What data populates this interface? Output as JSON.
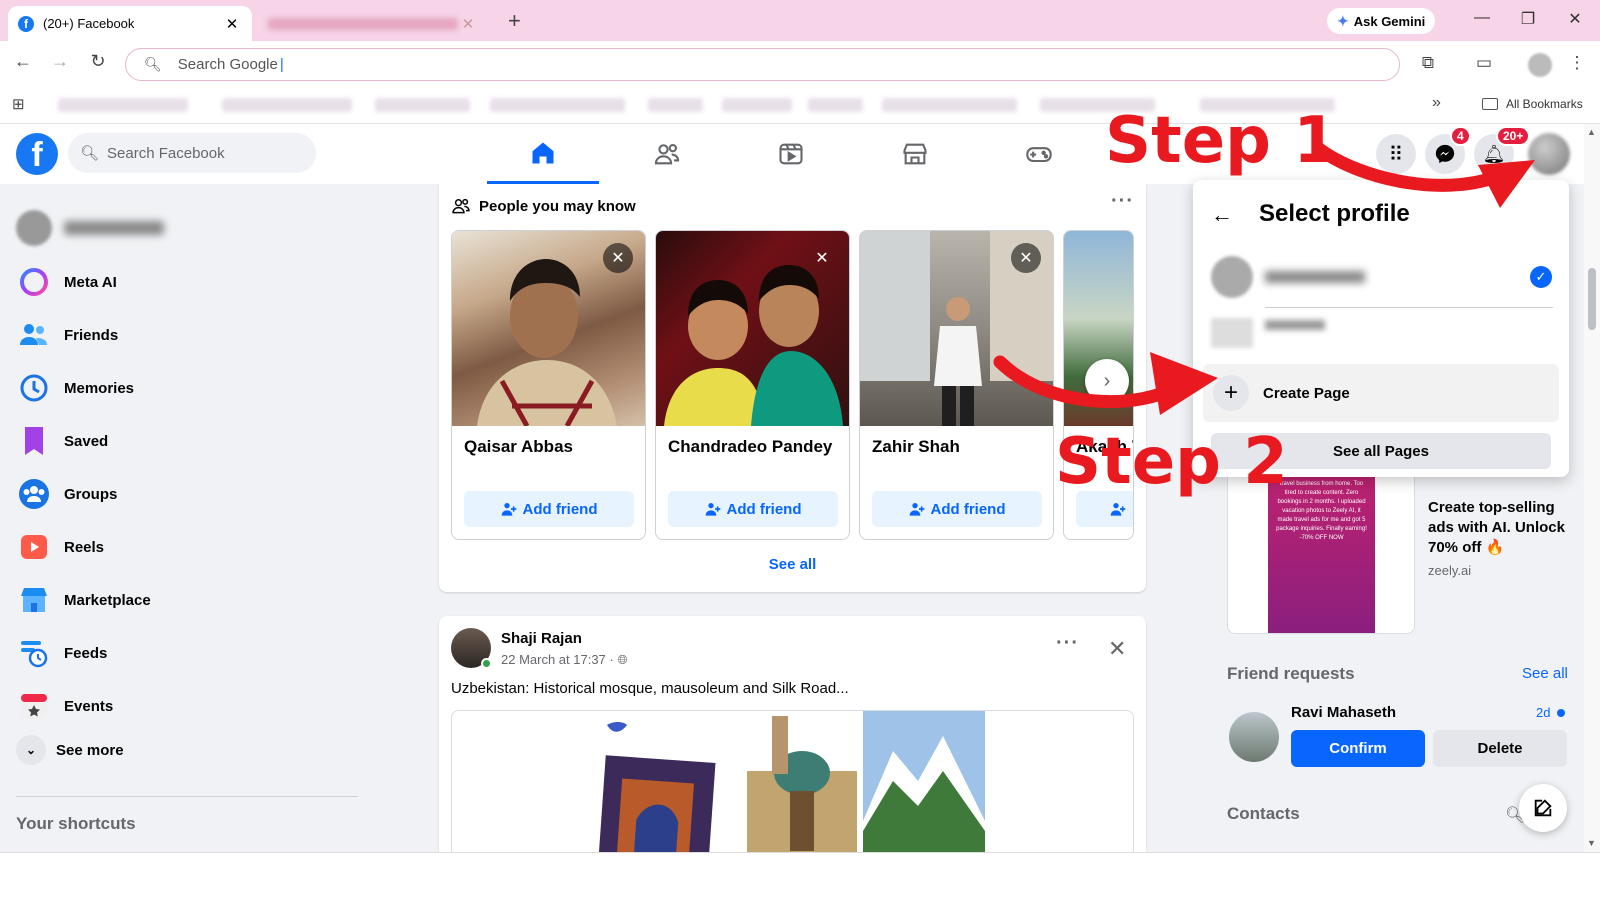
{
  "browser": {
    "active_tab_title": "(20+) Facebook",
    "new_tab_icon": "plus-icon",
    "ask_gemini_label": "Ask Gemini",
    "address_placeholder": "Search Google",
    "all_bookmarks_label": "All Bookmarks"
  },
  "fb_header": {
    "logo_letter": "f",
    "search_placeholder": "Search Facebook",
    "nav_tabs": [
      "home",
      "friends",
      "video",
      "marketplace",
      "gaming"
    ],
    "messenger_badge": "4",
    "notifications_badge": "20+"
  },
  "sidebar": {
    "items": [
      {
        "label": "Meta AI",
        "icon": "meta-ai-icon"
      },
      {
        "label": "Friends",
        "icon": "friends-icon"
      },
      {
        "label": "Memories",
        "icon": "memories-icon"
      },
      {
        "label": "Saved",
        "icon": "saved-icon"
      },
      {
        "label": "Groups",
        "icon": "groups-icon"
      },
      {
        "label": "Reels",
        "icon": "reels-icon"
      },
      {
        "label": "Marketplace",
        "icon": "marketplace-icon"
      },
      {
        "label": "Feeds",
        "icon": "feeds-icon"
      },
      {
        "label": "Events",
        "icon": "events-icon"
      }
    ],
    "see_more_label": "See more",
    "shortcuts_heading": "Your shortcuts"
  },
  "pymk": {
    "heading": "People you may know",
    "people": [
      {
        "name": "Qaisar Abbas",
        "add_label": "Add friend"
      },
      {
        "name": "Chandradeo Pandey",
        "add_label": "Add friend"
      },
      {
        "name": "Zahir Shah",
        "add_label": "Add friend"
      },
      {
        "name": "Akash V",
        "add_label": ""
      }
    ],
    "see_all_label": "See all"
  },
  "post": {
    "author": "Shaji Rajan",
    "time": "22 March at 17:37 · ",
    "text": "Uzbekistan: Historical mosque, mausoleum and Silk Road..."
  },
  "ad": {
    "title": "Create top-selling ads with AI. Unlock 70% off 🔥",
    "domain": "zeely.ai",
    "image_text": "POV: I'm a mom who started a travel business from home. Too tired to create content. Zero bookings in 2 months. I uploaded vacation photos to Zeely AI, it made travel ads for me and got 5 package inquiries. Finally earning! -70% OFF NOW"
  },
  "friend_requests": {
    "heading": "Friend requests",
    "see_all_label": "See all",
    "request": {
      "name": "Ravi Mahaseth",
      "time": "2d",
      "confirm_label": "Confirm",
      "delete_label": "Delete"
    }
  },
  "contacts": {
    "heading": "Contacts"
  },
  "select_profile": {
    "title": "Select profile",
    "create_page_label": "Create Page",
    "see_all_pages_label": "See all Pages"
  },
  "annotations": {
    "step1": "Step 1",
    "step2": "Step 2",
    "color": "#e8191f"
  }
}
